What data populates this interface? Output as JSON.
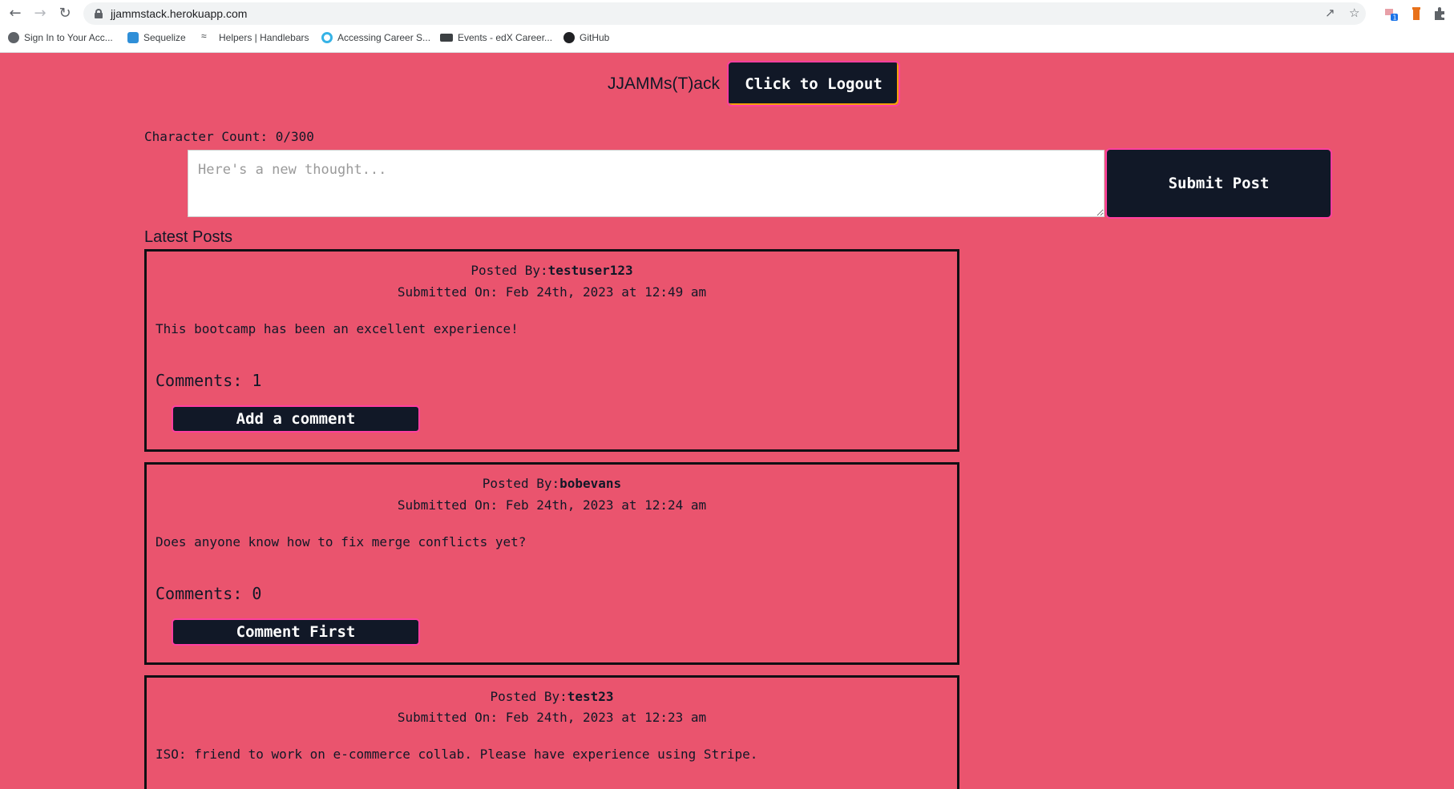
{
  "browser": {
    "url": "jjammstack.herokuapp.com",
    "bookmarks": [
      {
        "label": "Sign In to Your Acc...",
        "icon": "globe-icon"
      },
      {
        "label": "Sequelize",
        "icon": "sequelize-icon"
      },
      {
        "label": "Helpers | Handlebars",
        "icon": "handlebars-icon"
      },
      {
        "label": "Accessing Career S...",
        "icon": "career-icon"
      },
      {
        "label": "Events - edX Career...",
        "icon": "edx-icon"
      },
      {
        "label": "GitHub",
        "icon": "github-icon"
      }
    ],
    "extension_badge": "1"
  },
  "header": {
    "brand": "JJAMMs(T)ack",
    "logout_label": "Click to Logout"
  },
  "composer": {
    "char_count": "Character Count: 0/300",
    "placeholder": "Here's a new thought...",
    "value": "",
    "submit_label": "Submit Post"
  },
  "feed": {
    "heading": "Latest Posts",
    "posts": [
      {
        "posted_by_label": "Posted By:",
        "user": "testuser123",
        "submitted": "Submitted On: Feb 24th, 2023 at 12:49 am",
        "body": "This bootcamp has been an excellent experience!",
        "comments": "Comments: 1",
        "button": "Add a comment"
      },
      {
        "posted_by_label": "Posted By:",
        "user": "bobevans",
        "submitted": "Submitted On: Feb 24th, 2023 at 12:24 am",
        "body": "Does anyone know how to fix merge conflicts yet?",
        "comments": "Comments: 0",
        "button": "Comment First"
      },
      {
        "posted_by_label": "Posted By:",
        "user": "test23",
        "submitted": "Submitted On: Feb 24th, 2023 at 12:23 am",
        "body": "ISO: friend to work on e-commerce collab. Please have experience using Stripe."
      }
    ]
  },
  "colors": {
    "page_bg": "#ea546e",
    "button_bg": "#111827",
    "button_border": "#ff3fa0"
  }
}
